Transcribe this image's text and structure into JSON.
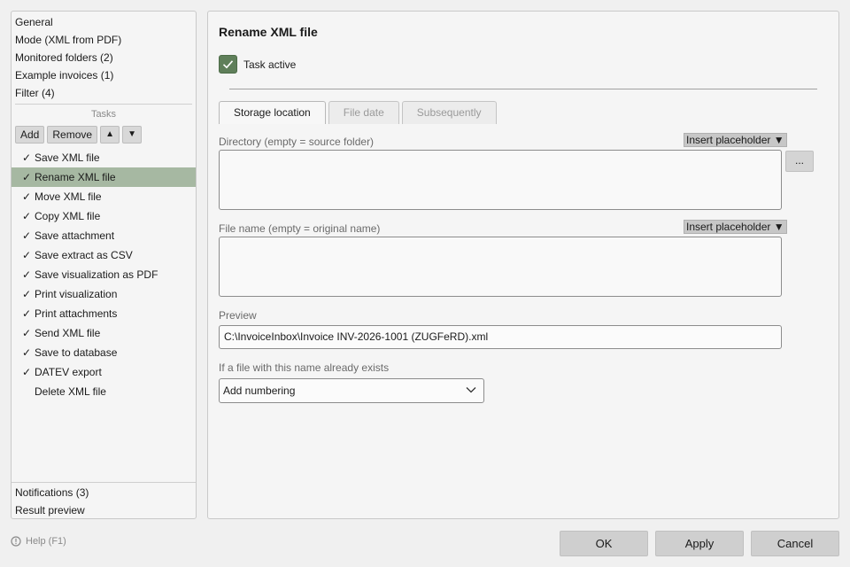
{
  "sidebar": {
    "nav_top": [
      "General",
      "Mode (XML from PDF)",
      "Monitored folders (2)",
      "Example invoices (1)",
      "Filter (4)"
    ],
    "tasks_heading": "Tasks",
    "toolbar": {
      "add": "Add",
      "remove": "Remove",
      "up": "▲",
      "down": "▼"
    },
    "tasks": [
      {
        "label": "Save XML file",
        "checked": true
      },
      {
        "label": "Rename XML file",
        "checked": true,
        "selected": true
      },
      {
        "label": "Move XML file",
        "checked": true
      },
      {
        "label": "Copy XML file",
        "checked": true
      },
      {
        "label": "Save attachment",
        "checked": true
      },
      {
        "label": "Save extract as CSV",
        "checked": true
      },
      {
        "label": "Save visualization as PDF",
        "checked": true
      },
      {
        "label": "Print visualization",
        "checked": true
      },
      {
        "label": "Print attachments",
        "checked": true
      },
      {
        "label": "Send XML file",
        "checked": true
      },
      {
        "label": "Save to database",
        "checked": true
      },
      {
        "label": "DATEV export",
        "checked": true
      },
      {
        "label": "Delete XML file",
        "checked": false
      }
    ],
    "nav_bottom": [
      "Notifications (3)",
      "Result preview"
    ]
  },
  "main": {
    "title": "Rename XML file",
    "task_active_label": "Task active",
    "task_active": true,
    "tabs": [
      {
        "label": "Storage location",
        "active": true
      },
      {
        "label": "File date",
        "active": false
      },
      {
        "label": "Subsequently",
        "active": false
      }
    ],
    "directory_label": "Directory (empty = source folder)",
    "directory_value": "",
    "insert_placeholder": "Insert placeholder ▼",
    "browse_label": "...",
    "filename_label": "File name (empty = original name)",
    "filename_value": "",
    "preview_label": "Preview",
    "preview_value": "C:\\InvoiceInbox\\Invoice INV-2026-1001 (ZUGFeRD).xml",
    "exists_label": "If a file with this name already exists",
    "exists_value": "Add numbering"
  },
  "footer": {
    "help": "Help (F1)",
    "ok": "OK",
    "apply": "Apply",
    "cancel": "Cancel"
  },
  "colors": {
    "selected_row": "#a6b8a2",
    "checkbox": "#5f7f5a"
  }
}
